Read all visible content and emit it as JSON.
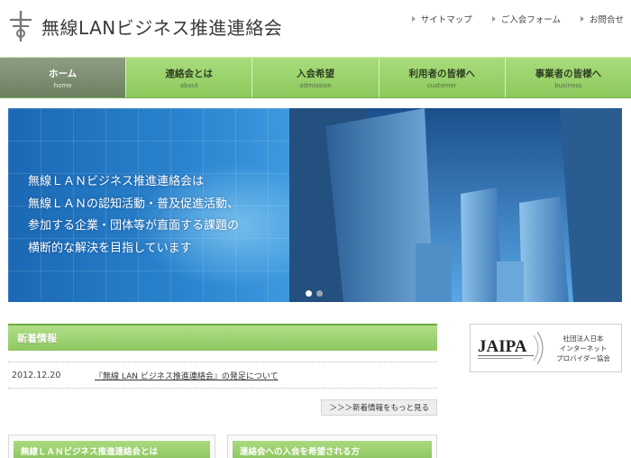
{
  "header": {
    "site_title": "無線LANビジネス推進連絡会",
    "links": [
      {
        "label": "サイトマップ"
      },
      {
        "label": "ご入会フォーム"
      },
      {
        "label": "お問合せ"
      }
    ]
  },
  "nav": {
    "items": [
      {
        "label": "ホーム",
        "sub": "home"
      },
      {
        "label": "連絡会とは",
        "sub": "about"
      },
      {
        "label": "入会希望",
        "sub": "admission"
      },
      {
        "label": "利用者の皆様へ",
        "sub": "customer"
      },
      {
        "label": "事業者の皆様へ",
        "sub": "business"
      }
    ]
  },
  "hero": {
    "lines": [
      "無線ＬＡＮビジネス推進連絡会は",
      "無線ＬＡＮの認知活動・普及促進活動、",
      "参加する企業・団体等が直面する課題の",
      "横断的な解決を目指しています"
    ]
  },
  "news": {
    "title": "新着情報",
    "items": [
      {
        "date": "2012.12.20",
        "text": "『無線 LAN ビジネス推進連絡会』の発足について"
      }
    ],
    "more_label": "＞＞＞新着情報をもっと見る"
  },
  "jaipa": {
    "lines": [
      "社団法人日本",
      "インターネット",
      "プロバイダー協会"
    ]
  },
  "boxes": [
    {
      "title": "無線ＬＡＮビジネス推進連絡会とは"
    },
    {
      "title": "連絡会への入会を希望される方"
    }
  ],
  "colors": {
    "nav_green": "#9ed46f",
    "nav_active": "#7b8c6f",
    "hero_blue": "#2b85d0"
  }
}
